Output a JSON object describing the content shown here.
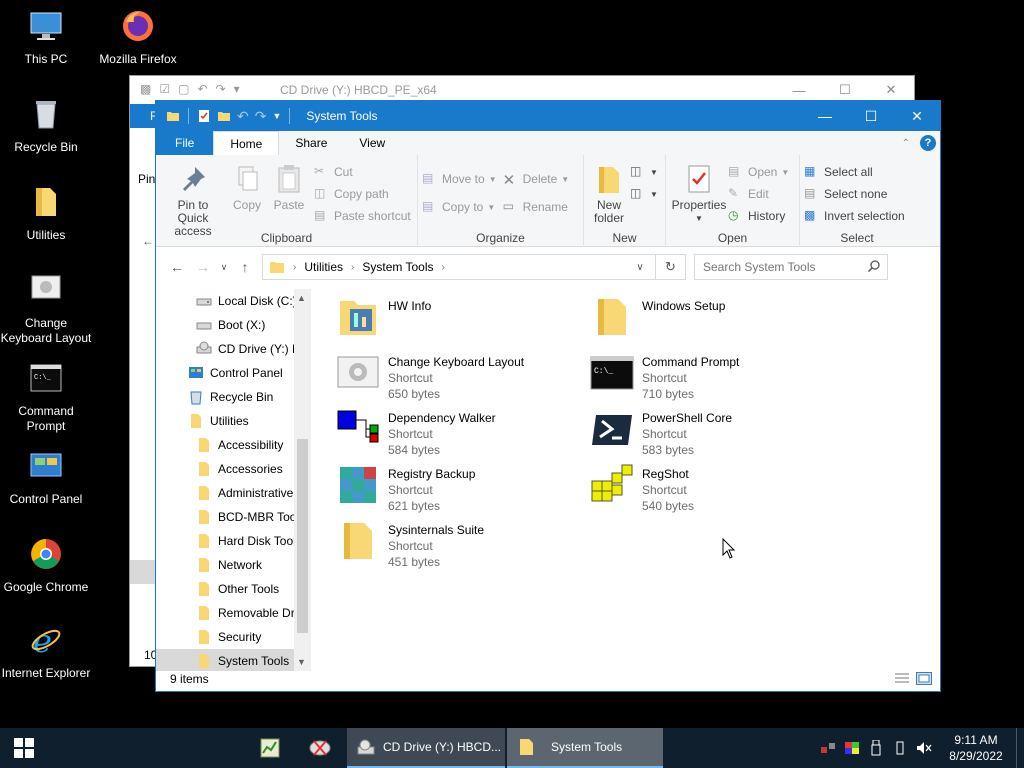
{
  "desktop": {
    "icons": [
      {
        "label": "This PC"
      },
      {
        "label": "Mozilla Firefox"
      },
      {
        "label": "Recycle Bin"
      },
      {
        "label": "Utilities"
      },
      {
        "label": "Change Keyboard Layout"
      },
      {
        "label": "Command Prompt"
      },
      {
        "label": "Control Panel"
      },
      {
        "label": "Google Chrome"
      },
      {
        "label": "Internet Explorer"
      }
    ]
  },
  "back_window": {
    "title": "CD Drive (Y:) HBCD_PE_x64",
    "tab_fragment": "F",
    "pin_fragment": "Pin",
    "status_fragment": "10"
  },
  "window": {
    "title": "System Tools",
    "tabs": [
      "File",
      "Home",
      "Share",
      "View"
    ],
    "ribbon": {
      "clipboard": {
        "pin_label": "Pin to Quick access",
        "copy_label": "Copy",
        "paste_label": "Paste",
        "cut_label": "Cut",
        "copy_path_label": "Copy path",
        "paste_shortcut_label": "Paste shortcut",
        "group_label": "Clipboard"
      },
      "organize": {
        "move_to_label": "Move to",
        "copy_to_label": "Copy to",
        "delete_label": "Delete",
        "rename_label": "Rename",
        "group_label": "Organize"
      },
      "new": {
        "new_folder_label": "New folder",
        "group_label": "New"
      },
      "open": {
        "properties_label": "Properties",
        "open_label": "Open",
        "edit_label": "Edit",
        "history_label": "History",
        "group_label": "Open"
      },
      "select": {
        "select_all_label": "Select all",
        "select_none_label": "Select none",
        "invert_label": "Invert selection",
        "group_label": "Select"
      }
    },
    "address": {
      "crumbs": [
        "Utilities",
        "System Tools"
      ],
      "search_placeholder": "Search System Tools"
    },
    "nav": [
      {
        "label": "Local Disk (C:)"
      },
      {
        "label": "Boot (X:)"
      },
      {
        "label": "CD Drive (Y:) H"
      },
      {
        "label": "Control Panel"
      },
      {
        "label": "Recycle Bin"
      },
      {
        "label": "Utilities"
      },
      {
        "label": "Accessibility"
      },
      {
        "label": "Accessories"
      },
      {
        "label": "Administrative"
      },
      {
        "label": "BCD-MBR Tool"
      },
      {
        "label": "Hard Disk Tools"
      },
      {
        "label": "Network"
      },
      {
        "label": "Other Tools"
      },
      {
        "label": "Removable Dri"
      },
      {
        "label": "Security"
      },
      {
        "label": "System Tools"
      }
    ],
    "items": [
      {
        "name": "HW Info",
        "type": "",
        "size": ""
      },
      {
        "name": "Windows Setup",
        "type": "",
        "size": ""
      },
      {
        "name": "Change Keyboard Layout",
        "type": "Shortcut",
        "size": "650 bytes"
      },
      {
        "name": "Command Prompt",
        "type": "Shortcut",
        "size": "710 bytes"
      },
      {
        "name": "Dependency Walker",
        "type": "Shortcut",
        "size": "584 bytes"
      },
      {
        "name": "PowerShell Core",
        "type": "Shortcut",
        "size": "583 bytes"
      },
      {
        "name": "Registry Backup",
        "type": "Shortcut",
        "size": "621 bytes"
      },
      {
        "name": "RegShot",
        "type": "Shortcut",
        "size": "540 bytes"
      },
      {
        "name": "Sysinternals Suite",
        "type": "Shortcut",
        "size": "451 bytes"
      }
    ],
    "status": "9 items"
  },
  "taskbar": {
    "tasks": [
      {
        "label": "CD Drive (Y:) HBCD..."
      },
      {
        "label": "System Tools"
      }
    ],
    "time": "9:11 AM",
    "date": "8/29/2022"
  },
  "colors": {
    "accent": "#1979ca",
    "taskbar": "#101f2e",
    "folder": "#f8d775"
  }
}
